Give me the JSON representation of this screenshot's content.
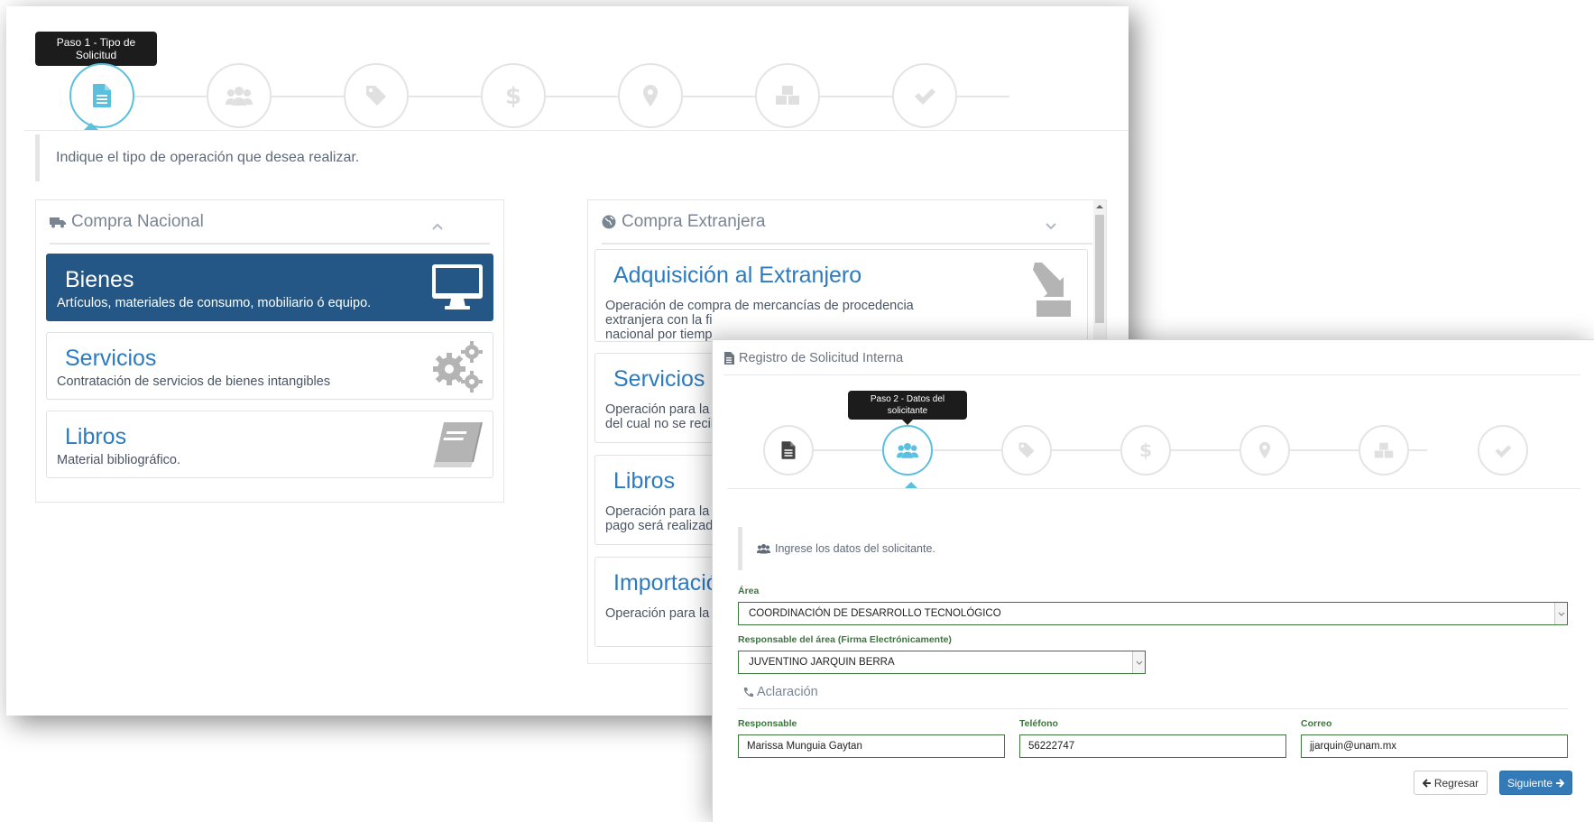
{
  "window1": {
    "tooltip": "Paso 1 - Tipo de Solicitud",
    "steps": [
      {
        "icon": "file-text-icon",
        "active": true
      },
      {
        "icon": "users-icon",
        "active": false
      },
      {
        "icon": "tag-icon",
        "active": false
      },
      {
        "icon": "dollar-icon",
        "active": false
      },
      {
        "icon": "map-marker-icon",
        "active": false
      },
      {
        "icon": "cubes-icon",
        "active": false
      },
      {
        "icon": "check-icon",
        "active": false
      }
    ],
    "instruction": "Indique el tipo de operación que desea realizar.",
    "nacional": {
      "heading": "Compra Nacional",
      "cards": [
        {
          "title": "Bienes",
          "desc": "Artículos, materiales de consumo, mobiliario ó equipo.",
          "icon": "desktop-icon",
          "selected": true
        },
        {
          "title": "Servicios",
          "desc": "Contratación de servicios de bienes intangibles",
          "icon": "gears-icon",
          "selected": false
        },
        {
          "title": "Libros",
          "desc": "Material bibliográfico.",
          "icon": "book-icon",
          "selected": false
        }
      ]
    },
    "extranjera": {
      "heading": "Compra Extranjera",
      "cards": [
        {
          "title": "Adquisición al Extranjero",
          "desc": [
            "Operación de compra de mercancías de procedencia",
            "extranjera con la fi",
            "nacional por tiemp"
          ],
          "icon": "import-icon"
        },
        {
          "title": "Servicios",
          "desc": [
            "Operación para la",
            "del cual no se recil"
          ]
        },
        {
          "title": "Libros",
          "desc": [
            "Operación para la",
            "pago será realizad"
          ]
        },
        {
          "title": "Importació",
          "desc": [
            "Operación para la"
          ]
        }
      ]
    }
  },
  "window2": {
    "title": "Registro de Solicitud Interna",
    "tooltip": [
      "Paso 2 - Datos del",
      "solicitante"
    ],
    "steps": [
      {
        "icon": "file-text-icon",
        "active": false
      },
      {
        "icon": "users-icon",
        "active": true
      },
      {
        "icon": "tag-icon",
        "active": false
      },
      {
        "icon": "dollar-icon",
        "active": false
      },
      {
        "icon": "map-marker-icon",
        "active": false
      },
      {
        "icon": "cubes-icon",
        "active": false
      },
      {
        "icon": "check-icon",
        "active": false
      }
    ],
    "instruction": "Ingrese los datos del solicitante.",
    "area_label": "Área",
    "area_value": "COORDINACIÓN DE DESARROLLO TECNOLÓGICO",
    "responsable_area_label": "Responsable del área (Firma Electrónicamente)",
    "responsable_area_value": "JUVENTINO JARQUIN BERRA",
    "aclaracion_heading": "Aclaración",
    "responsable_label": "Responsable",
    "responsable_value": "Marissa Munguia Gaytan",
    "telefono_label": "Teléfono",
    "telefono_value": "56222747",
    "correo_label": "Correo",
    "correo_value": "jjarquin@unam.mx",
    "back_label": "Regresar",
    "next_label": "Siguiente"
  },
  "colors": {
    "accent": "#5bc0de",
    "selected_card": "#245785",
    "title_blue": "#2d7bbf",
    "primary_button": "#337ab7",
    "success_border": "#3c763d"
  }
}
